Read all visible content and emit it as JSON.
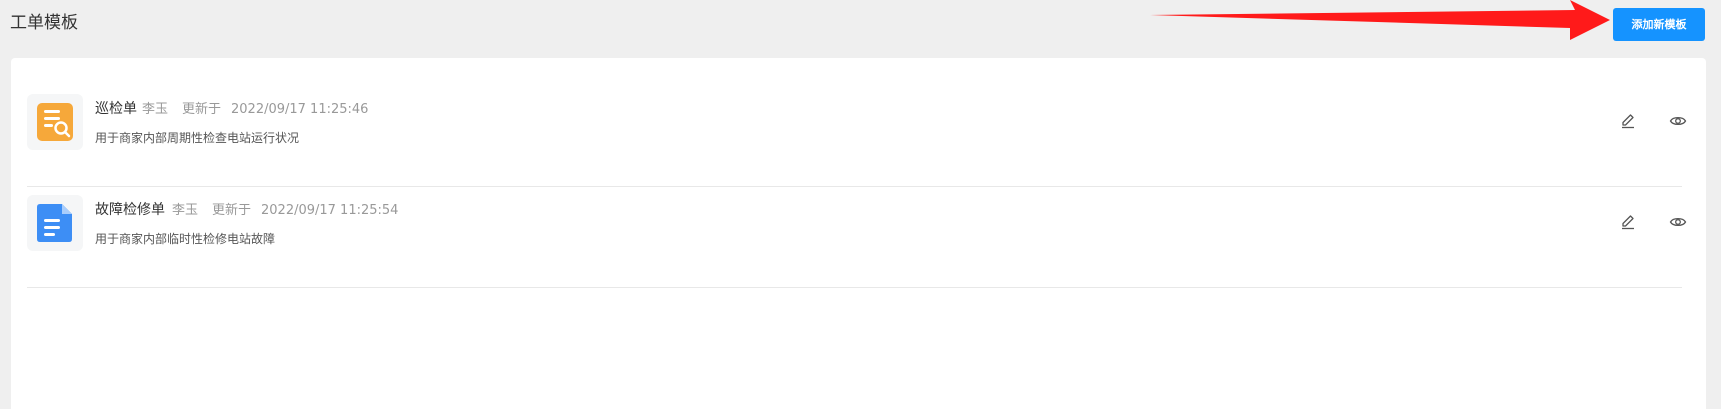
{
  "header": {
    "title": "工单模板",
    "add_button_label": "添加新模板"
  },
  "templates": [
    {
      "name": "巡检单",
      "author": "李玉",
      "updated_label": "更新于",
      "updated_at": "2022/09/17 11:25:46",
      "description": "用于商家内部周期性检查电站运行状况",
      "icon": "inspection-doc-search-icon",
      "icon_color": "#f5a030"
    },
    {
      "name": "故障检修单",
      "author": "李玉",
      "updated_label": "更新于",
      "updated_at": "2022/09/17 11:25:54",
      "description": "用于商家内部临时性检修电站故障",
      "icon": "repair-document-icon",
      "icon_color": "#3d8ef5"
    }
  ],
  "actions": {
    "edit_icon": "pencil-icon",
    "view_icon": "eye-icon"
  },
  "colors": {
    "primary": "#1593ff",
    "annotation_arrow": "#ff1a1a"
  }
}
